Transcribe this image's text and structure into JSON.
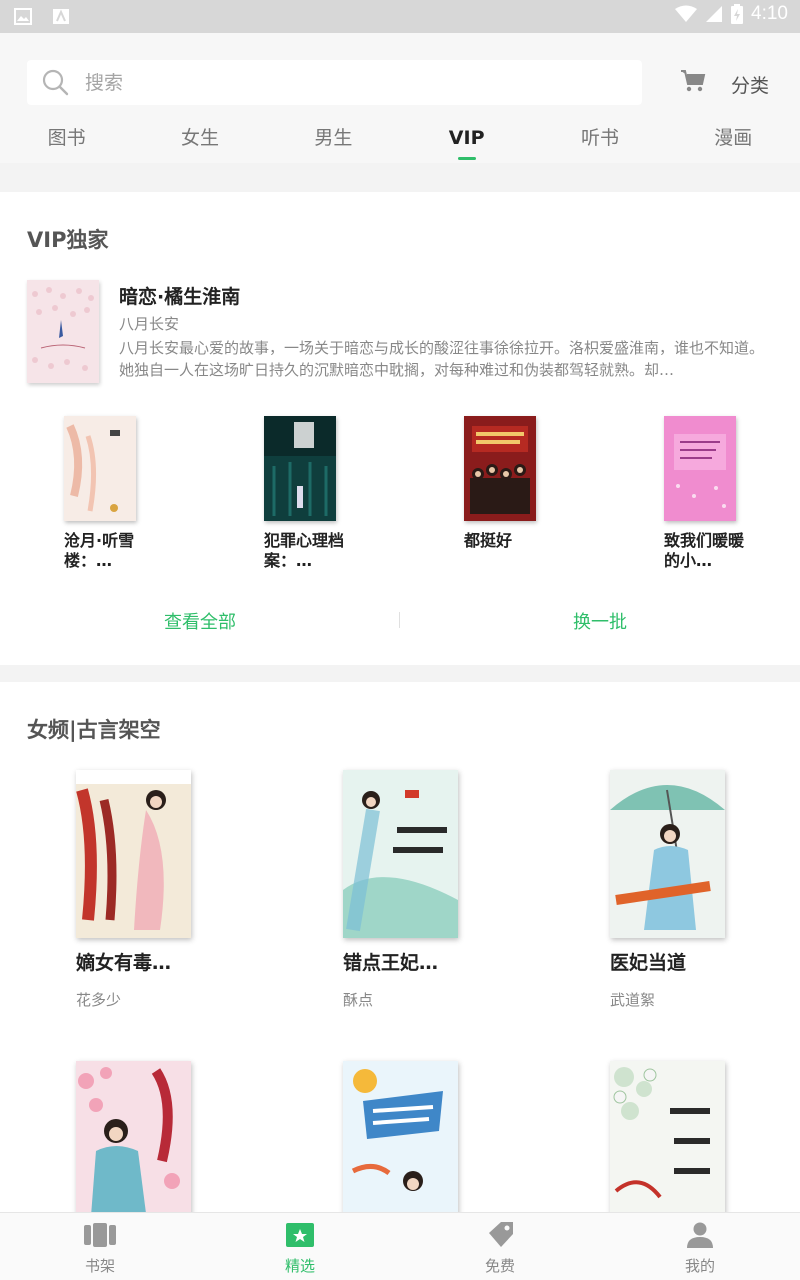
{
  "status_bar": {
    "time": "4:10"
  },
  "search": {
    "placeholder": "搜索"
  },
  "header": {
    "category_label": "分类"
  },
  "tabs": [
    {
      "label": "图书"
    },
    {
      "label": "女生"
    },
    {
      "label": "男生"
    },
    {
      "label": "VIP",
      "active": true
    },
    {
      "label": "听书"
    },
    {
      "label": "漫画"
    }
  ],
  "vip_section": {
    "title": "VIP独家",
    "featured": {
      "title": "暗恋·橘生淮南",
      "author": "八月长安",
      "description": "八月长安最心爱的故事，一场关于暗恋与成长的酸涩往事徐徐拉开。洛枳爱盛淮南，谁也不知道。她独自一人在这场旷日持久的沉默暗恋中耽搁，对每种难过和伪装都驾轻就熟。却…"
    },
    "books": [
      {
        "name": "沧月·听雪楼：…"
      },
      {
        "name": "犯罪心理档案：…"
      },
      {
        "name": "都挺好"
      },
      {
        "name": "致我们暖暖的小…"
      }
    ],
    "view_all_label": "查看全部",
    "refresh_label": "换一批"
  },
  "female_section": {
    "title": "女频|古言架空",
    "books": [
      {
        "name": "嫡女有毒…",
        "author": "花多少"
      },
      {
        "name": "错点王妃…",
        "author": "酥点"
      },
      {
        "name": "医妃当道",
        "author": "武道絮"
      },
      {
        "name": "",
        "author": ""
      },
      {
        "name": "",
        "author": ""
      },
      {
        "name": "",
        "author": ""
      }
    ]
  },
  "bottom_nav": [
    {
      "label": "书架",
      "icon": "bookshelf-icon"
    },
    {
      "label": "精选",
      "icon": "featured-icon",
      "active": true
    },
    {
      "label": "免费",
      "icon": "tag-icon"
    },
    {
      "label": "我的",
      "icon": "profile-icon"
    }
  ],
  "colors": {
    "accent": "#2fbe6a",
    "status_bar": "#d7d7d7"
  }
}
